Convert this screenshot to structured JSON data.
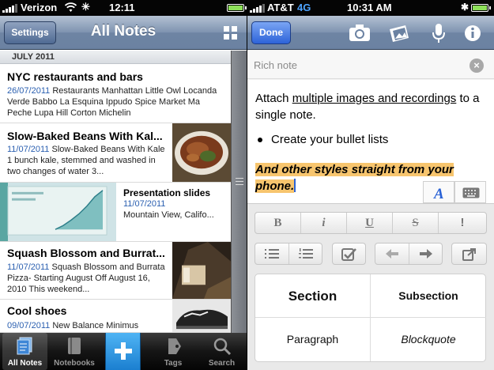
{
  "left_status": {
    "carrier": "Verizon",
    "time": "12:11"
  },
  "right_status": {
    "carrier": "AT&T",
    "network": "4G",
    "time": "10:31 AM"
  },
  "left_nav": {
    "settings_label": "Settings",
    "title": "All Notes",
    "view_icon": "grid-icon"
  },
  "section_header": "JULY 2011",
  "notes": [
    {
      "title": "NYC restaurants and bars",
      "date": "26/07/2011",
      "snippet": "Restaurants Manhattan Little Owl Locanda Verde Babbo La Esquina Ippudo Spice Market Ma Peche Lupa Hill Corton Michelin"
    },
    {
      "title": "Slow-Baked Beans With Kal...",
      "date": "11/07/2011",
      "snippet": "Slow-Baked Beans With Kale 1 bunch kale, stemmed and washed in two changes of water 3..."
    },
    {
      "title": "Presentation slides",
      "date": "11/07/2011",
      "snippet": "Mountain View, Califo..."
    },
    {
      "title": "Squash Blossom and Burrat...",
      "date": "11/07/2011",
      "snippet": "Squash Blossom and Burrata Pizza- Starting August Off August 16, 2010 This weekend..."
    },
    {
      "title": "Cool shoes",
      "date": "09/07/2011",
      "snippet": "New Balance Minimus"
    }
  ],
  "tabs": [
    {
      "label": "All Notes",
      "icon": "all-notes-icon"
    },
    {
      "label": "Notebooks",
      "icon": "notebook-icon"
    },
    {
      "label": "",
      "icon": "plus-icon"
    },
    {
      "label": "Tags",
      "icon": "tag-icon"
    },
    {
      "label": "Search",
      "icon": "search-icon"
    }
  ],
  "right_nav": {
    "done_label": "Done",
    "icons": [
      "camera-icon",
      "photo-icon",
      "microphone-icon",
      "info-icon"
    ]
  },
  "editor": {
    "title_placeholder": "Rich note",
    "para_part1": "Attach ",
    "para_underlined": "multiple images and recordings",
    "para_part2": " to a single note.",
    "bullet": "Create your bullet lists",
    "highlighted": "And other styles straight from your phone.",
    "highlight_color": "#f7c56e"
  },
  "format_buttons": {
    "bold": "B",
    "italic": "i",
    "underline": "U",
    "strike": "S",
    "exclaim": "!"
  },
  "styles": {
    "section": "Section",
    "subsection": "Subsection",
    "paragraph": "Paragraph",
    "blockquote": "Blockquote"
  },
  "colors": {
    "nav_blue": "#7e93b0",
    "done_blue": "#2d63d9",
    "plus_blue": "#1b7fd0",
    "date_blue": "#2a5fb0"
  }
}
